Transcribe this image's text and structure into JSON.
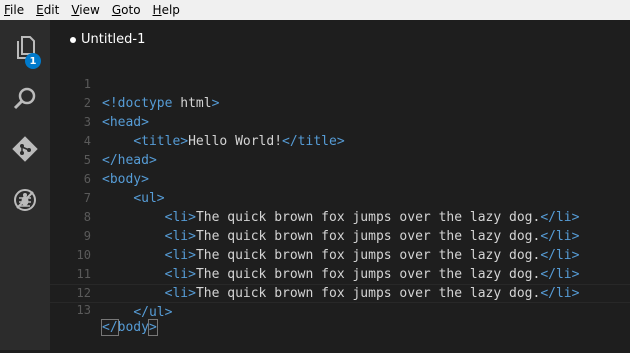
{
  "menu": [
    {
      "mnemonic": "F",
      "rest": "ile"
    },
    {
      "mnemonic": "E",
      "rest": "dit"
    },
    {
      "mnemonic": "V",
      "rest": "iew"
    },
    {
      "mnemonic": "G",
      "rest": "oto"
    },
    {
      "mnemonic": "H",
      "rest": "elp"
    }
  ],
  "activitybar": {
    "explorer_badge": "1"
  },
  "tab": {
    "title": "Untitled-1"
  },
  "code": {
    "line_numbers": [
      "1",
      "2",
      "3",
      "4",
      "5",
      "6",
      "7",
      "8",
      "9",
      "10",
      "11",
      "12",
      "13"
    ],
    "doctype_open": "<!doctype",
    "doctype_name": "html",
    "doctype_close": ">",
    "head_open": "<head>",
    "title_open": "<title>",
    "title_text": "Hello World!",
    "title_close": "</title>",
    "head_close": "</head>",
    "body_open": "<body>",
    "ul_open": "<ul>",
    "li_items": [
      "The quick brown fox jumps over the lazy dog.",
      "The quick brown fox jumps over the lazy dog.",
      "The quick brown fox jumps over the lazy dog.",
      "The quick brown fox jumps over the lazy dog.",
      "The quick brown fox jumps over the lazy dog."
    ],
    "li_open": "<li>",
    "li_close": "</li>",
    "ul_close": "</ul>",
    "body_close_open": "</",
    "body_close_name": "body",
    "body_close_end": ">"
  },
  "colors": {
    "tag": "#569cd6",
    "text": "#d4d4d4",
    "line_number": "#5a5a5a",
    "badge": "#007acc"
  }
}
